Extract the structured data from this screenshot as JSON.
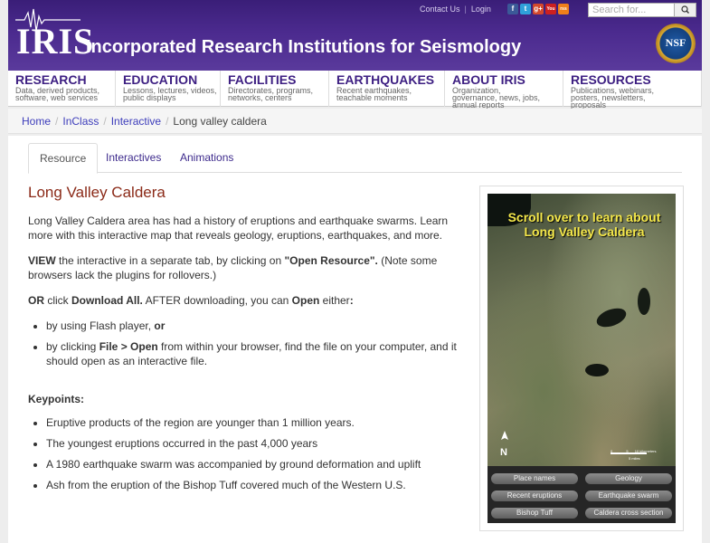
{
  "header": {
    "logo_text": "IRIS",
    "site_title": "Incorporated Research Institutions for Seismology",
    "contact_label": "Contact Us",
    "login_label": "Login",
    "search_placeholder": "Search for...",
    "nsf_text": "NSF",
    "social": [
      {
        "name": "facebook-icon",
        "glyph": "f",
        "color": "#3b5998"
      },
      {
        "name": "twitter-icon",
        "glyph": "t",
        "color": "#2fa0d9"
      },
      {
        "name": "googleplus-icon",
        "glyph": "g+",
        "color": "#d3492c"
      },
      {
        "name": "youtube-icon",
        "glyph": "You",
        "color": "#cc2020"
      },
      {
        "name": "rss-icon",
        "glyph": "rss",
        "color": "#ef7f1a"
      }
    ]
  },
  "nav": [
    {
      "title": "RESEARCH",
      "sub": "Data, derived products, software, web services"
    },
    {
      "title": "EDUCATION",
      "sub": "Lessons, lectures, videos, public displays"
    },
    {
      "title": "FACILITIES",
      "sub": "Directorates, programs, networks, centers"
    },
    {
      "title": "EARTHQUAKES",
      "sub": "Recent earthquakes, teachable moments"
    },
    {
      "title": "ABOUT IRIS",
      "sub": "Organization, governance, news, jobs, annual reports"
    },
    {
      "title": "RESOURCES",
      "sub": "Publications, webinars, posters, newsletters, proposals"
    }
  ],
  "breadcrumb": {
    "items": [
      "Home",
      "InClass",
      "Interactive"
    ],
    "current": "Long valley caldera"
  },
  "tabs": [
    "Resource",
    "Interactives",
    "Animations"
  ],
  "page_title": "Long Valley Caldera",
  "body": {
    "intro": "Long Valley Caldera area has had a history of eruptions and earthquake swarms.  Learn more with this interactive map that reveals geology, eruptions, earthquakes, and more.",
    "view_strong": "VIEW",
    "view_mid": " the interactive in a separate tab, by clicking on ",
    "view_quote": "\"Open Resource\".",
    "view_end": " (Note some browsers lack the plugins for rollovers.)",
    "or_strong": "OR",
    "or_mid": " click ",
    "download_strong": "Download All.",
    "after_text": "  AFTER downloading, you can ",
    "open_strong": "Open",
    "either": " either",
    "colon": ":",
    "bullet1_pre": "by using Flash player, ",
    "bullet1_strong": "or",
    "bullet2_pre": "by clicking ",
    "bullet2_strong": "File > Open",
    "bullet2_post": " from within your browser, find the file on your computer, and it should open as an interactive file.",
    "keypoints_label": "Keypoints:",
    "keypoints": [
      "Eruptive products of the region are younger than 1 million years.",
      "The youngest eruptions occurred in the past 4,000 years",
      "A 1980 earthquake swarm was accompanied by ground deformation and uplift",
      "Ash from the eruption of the Bishop Tuff covered much of the Western U.S."
    ]
  },
  "map": {
    "caption": "Scroll over to learn about Long Valley Caldera",
    "north_label": "N",
    "scale_km": "10 kilometers",
    "scale_mi": "5 miles",
    "scale_zero": "0",
    "scale_five": "5",
    "buttons": [
      "Place names",
      "Geology",
      "Recent eruptions",
      "Earthquake swarm",
      "Bishop Tuff",
      "Caldera cross section"
    ]
  }
}
